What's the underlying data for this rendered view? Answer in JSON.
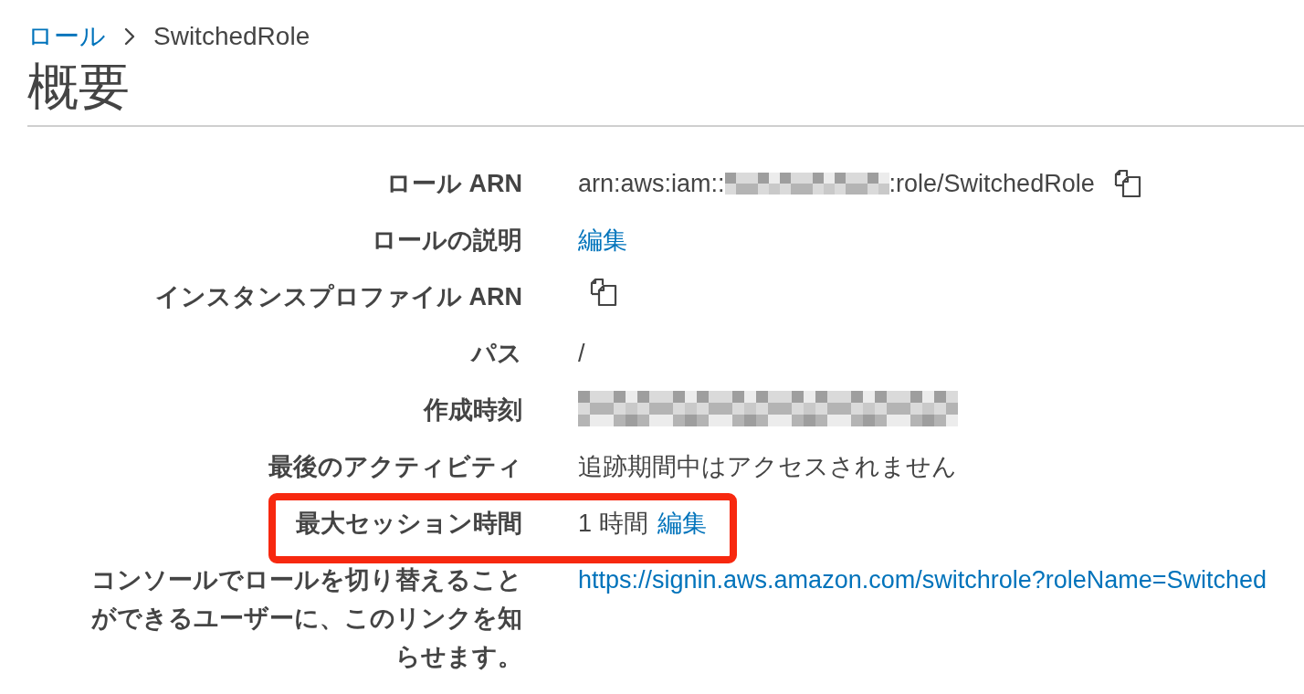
{
  "breadcrumb": [
    {
      "label": "ロール",
      "kind": "link"
    },
    {
      "label": "SwitchedRole",
      "kind": "current"
    }
  ],
  "title": "概要",
  "details": [
    {
      "label": "ロール ARN",
      "highlighted": false,
      "value": [
        {
          "kind": "text",
          "text": "arn:aws:iam::"
        },
        {
          "kind": "redacted_id"
        },
        {
          "kind": "text",
          "text": ":role/SwitchedRole"
        },
        {
          "kind": "copy"
        }
      ]
    },
    {
      "label": "ロールの説明",
      "highlighted": false,
      "value": [
        {
          "kind": "link",
          "text": "編集"
        }
      ]
    },
    {
      "label": "インスタンスプロファイル ARN",
      "highlighted": false,
      "value": [
        {
          "kind": "copy"
        }
      ]
    },
    {
      "label": "パス",
      "highlighted": false,
      "value": [
        {
          "kind": "text",
          "text": "/"
        }
      ]
    },
    {
      "label": "作成時刻",
      "highlighted": false,
      "value": [
        {
          "kind": "redacted_date"
        }
      ]
    },
    {
      "label": "最後のアクティビティ",
      "highlighted": false,
      "value": [
        {
          "kind": "text",
          "text": "追跡期間中はアクセスされません"
        }
      ]
    },
    {
      "label": "最大セッション時間",
      "highlighted": true,
      "value": [
        {
          "kind": "text",
          "text": "1 時間"
        },
        {
          "kind": "link",
          "text": "編集"
        }
      ]
    },
    {
      "label": "コンソールでロールを切り替えることができるユーザーに、このリンクを知らせます。",
      "highlighted": false,
      "value": [
        {
          "kind": "link",
          "text": "https://signin.aws.amazon.com/switchrole?roleName=Switched"
        }
      ]
    }
  ]
}
